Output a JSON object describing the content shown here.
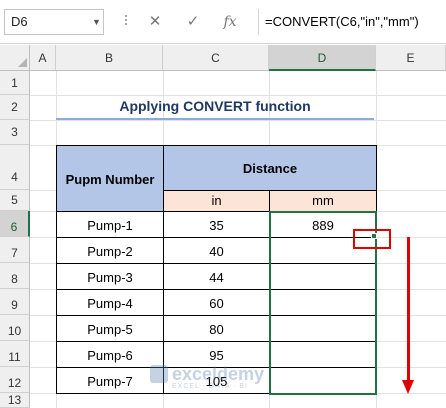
{
  "formula_bar": {
    "name_box": "D6",
    "cancel_icon": "✕",
    "enter_icon": "✓",
    "fx_label": "fx",
    "formula": "=CONVERT(C6,\"in\",\"mm\")"
  },
  "columns": [
    "A",
    "B",
    "C",
    "D",
    "E"
  ],
  "selected_column": "D",
  "rows": [
    "1",
    "2",
    "3",
    "4",
    "5",
    "6",
    "7",
    "8",
    "9",
    "10",
    "11",
    "12",
    "13"
  ],
  "selected_row": "6",
  "sheet": {
    "title": "Applying CONVERT function",
    "header_pump": "Pupm Number",
    "header_distance": "Distance",
    "header_in": "in",
    "header_mm": "mm",
    "table": [
      {
        "pump": "Pump-1",
        "in": "35",
        "mm": "889"
      },
      {
        "pump": "Pump-2",
        "in": "40",
        "mm": ""
      },
      {
        "pump": "Pump-3",
        "in": "44",
        "mm": ""
      },
      {
        "pump": "Pump-4",
        "in": "60",
        "mm": ""
      },
      {
        "pump": "Pump-5",
        "in": "80",
        "mm": ""
      },
      {
        "pump": "Pump-6",
        "in": "95",
        "mm": ""
      },
      {
        "pump": "Pump-7",
        "in": "105",
        "mm": ""
      }
    ]
  },
  "watermark": {
    "text": "exceldemy",
    "sub": "EXCEL · DATA · BI"
  },
  "colors": {
    "accent": "#217346",
    "annotation": "#e00000",
    "header_blue": "#b4c6e7",
    "header_peach": "#fce4d6"
  }
}
